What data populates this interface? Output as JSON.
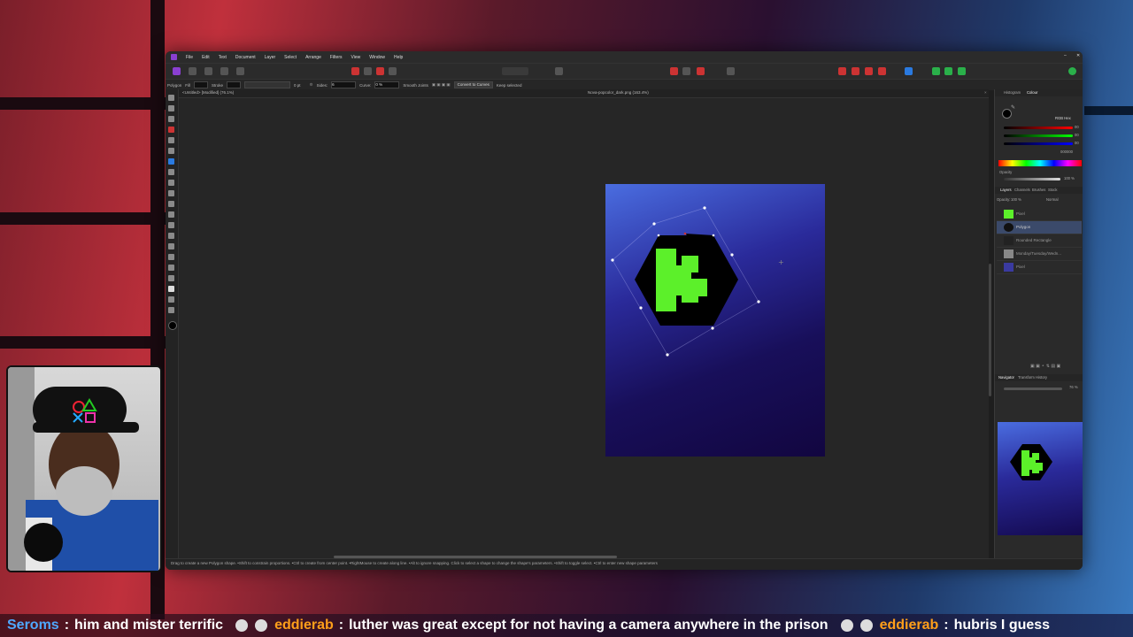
{
  "app": {
    "menu": [
      "File",
      "Edit",
      "Text",
      "Document",
      "Layer",
      "Select",
      "Arrange",
      "Filters",
      "View",
      "Window",
      "Help"
    ],
    "context_toolbar": {
      "tool_name": "Polygon",
      "fill_label": "Fill",
      "stroke_label": "Stroke",
      "stroke_width": "0 pt",
      "sides_label": "Sides:",
      "sides_value": "6",
      "curve_label": "Curve:",
      "curve_value": "0 %",
      "smooth_joints_label": "Smooth Joints",
      "convert_button": "Convert to Curves",
      "keep_selected_label": "Keep selected"
    },
    "tabs": [
      {
        "label": "<Untitled> [Modified] (76.1%)"
      },
      {
        "label": "Nova-popcolor_dark.png (163.4%)"
      }
    ],
    "status_text": "Drag to create a new Polygon shape. •Shift to constrain proportions. •Ctrl to create from center point. •RightMouse to create along line. •Alt to ignore snapping. Click to select a shape to change the shape's parameters. •Shift to toggle select. •Ctrl to enter new shape parameters",
    "panels": {
      "color_tabs": [
        "Histogram",
        "Colour"
      ],
      "color_model": "RGB Hex",
      "rgb_values": [
        "00",
        "00",
        "00"
      ],
      "hex_value": "000000",
      "opacity_label": "Opacity",
      "opacity_value": "100 %",
      "layer_tabs": [
        "Layers",
        "Channels",
        "Brushes",
        "Stock"
      ],
      "layer_opacity_label": "Opacity:",
      "layer_opacity_value": "100 %",
      "blend_mode": "Normal",
      "layers": [
        {
          "name": "Pixel",
          "thumb": "#5cf02a"
        },
        {
          "name": "Polygon",
          "thumb": "#111111"
        },
        {
          "name": "Rounded Rectangle",
          "thumb": "#222222"
        },
        {
          "name": "Monday/Tuesday/Wedn...",
          "thumb": "#888888"
        },
        {
          "name": "Pixel",
          "thumb": "#3a3aa0"
        }
      ],
      "nav_tabs": [
        "Navigator",
        "Transform",
        "History"
      ],
      "zoom_value": "76 %"
    }
  },
  "artwork": {
    "logo_letter": "K",
    "hex_color": "#000000",
    "letter_color": "#5cf02a"
  },
  "chat": [
    {
      "user": "Seroms",
      "user_color": "#4fa8ff",
      "message": "him and mister terrific"
    },
    {
      "user": "eddierab",
      "user_color": "#ff9f1a",
      "message": "luther was great except for not having a camera anywhere in the prison"
    },
    {
      "user": "eddierab",
      "user_color": "#ff9f1a",
      "message": "hubris I guess"
    }
  ]
}
